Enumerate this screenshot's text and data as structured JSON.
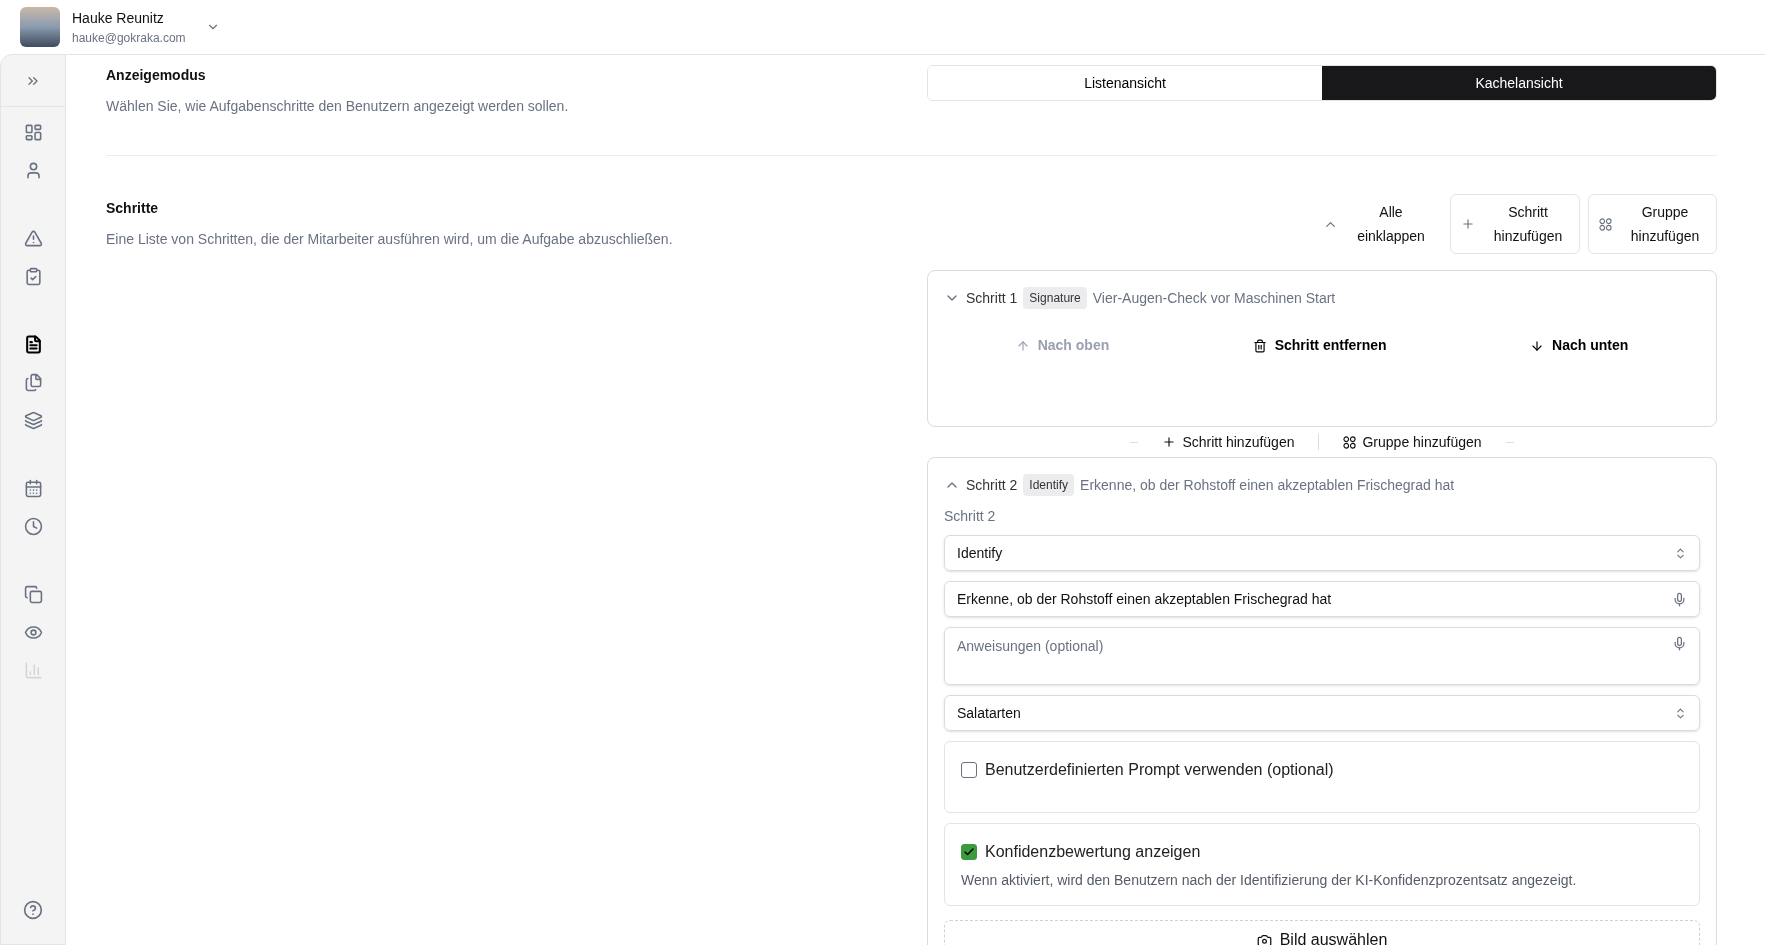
{
  "user": {
    "name": "Hauke Reunitz",
    "email": "hauke@gokraka.com"
  },
  "sidebar": {
    "items": [
      {
        "selected": false,
        "disabled": false
      },
      {
        "selected": false,
        "disabled": false
      },
      {
        "selected": false,
        "disabled": false
      },
      {
        "selected": false,
        "disabled": false
      },
      {
        "selected": true,
        "disabled": false
      },
      {
        "selected": false,
        "disabled": false
      },
      {
        "selected": false,
        "disabled": false
      },
      {
        "selected": false,
        "disabled": false
      },
      {
        "selected": false,
        "disabled": false
      },
      {
        "selected": false,
        "disabled": false
      },
      {
        "selected": false,
        "disabled": false
      },
      {
        "selected": false,
        "disabled": true
      }
    ]
  },
  "display_mode": {
    "title": "Anzeigemodus",
    "description": "Wählen Sie, wie Aufgabenschritte den Benutzern angezeigt werden sollen.",
    "options": [
      {
        "label": "Listenansicht",
        "selected": false
      },
      {
        "label": "Kachelansicht",
        "selected": true
      }
    ]
  },
  "steps_section": {
    "title": "Schritte",
    "description": "Eine Liste von Schritten, die der Mitarbeiter ausführen wird, um die Aufgabe abzuschließen.",
    "actions": [
      {
        "kind": "collapse",
        "label": "Alle einklappen"
      },
      {
        "kind": "add",
        "label": "Schritt hinzufügen"
      },
      {
        "kind": "group",
        "label": "Gruppe hinzufügen"
      }
    ],
    "steps": [
      {
        "title": "Schritt 1",
        "badge": "Signature",
        "summary": "Vier-Augen-Check vor Maschinen Start",
        "expanded": false,
        "moves": [
          {
            "kind": "up",
            "label": "Nach oben",
            "disabled": true
          },
          {
            "kind": "delete",
            "label": "Schritt entfernen",
            "disabled": false
          },
          {
            "kind": "down",
            "label": "Nach unten",
            "disabled": false
          }
        ]
      },
      {
        "title": "Schritt 2",
        "badge": "Identify",
        "summary": "Erkenne, ob der Rohstoff einen akzeptablen Frischegrad hat",
        "expanded": true,
        "label": "Schritt 2",
        "type_select": "Identify",
        "name_value": "Erkenne, ob der Rohstoff einen akzeptablen Frischegrad hat",
        "instructions_placeholder": "Anweisungen (optional)",
        "list_select": "Salatarten",
        "options": [
          {
            "label": "Benutzerdefinierten Prompt verwenden (optional)",
            "checked": false
          },
          {
            "label": "Konfidenzbewertung anzeigen",
            "checked": true,
            "hint": "Wenn aktiviert, wird den Benutzern nach der Identifizierung der KI-Konfidenzprozentsatz angezeigt."
          }
        ],
        "image_button": "Bild auswählen"
      }
    ],
    "between_actions": [
      {
        "kind": "add",
        "label": "Schritt hinzufügen"
      },
      {
        "kind": "group",
        "label": "Gruppe hinzufügen"
      }
    ]
  }
}
